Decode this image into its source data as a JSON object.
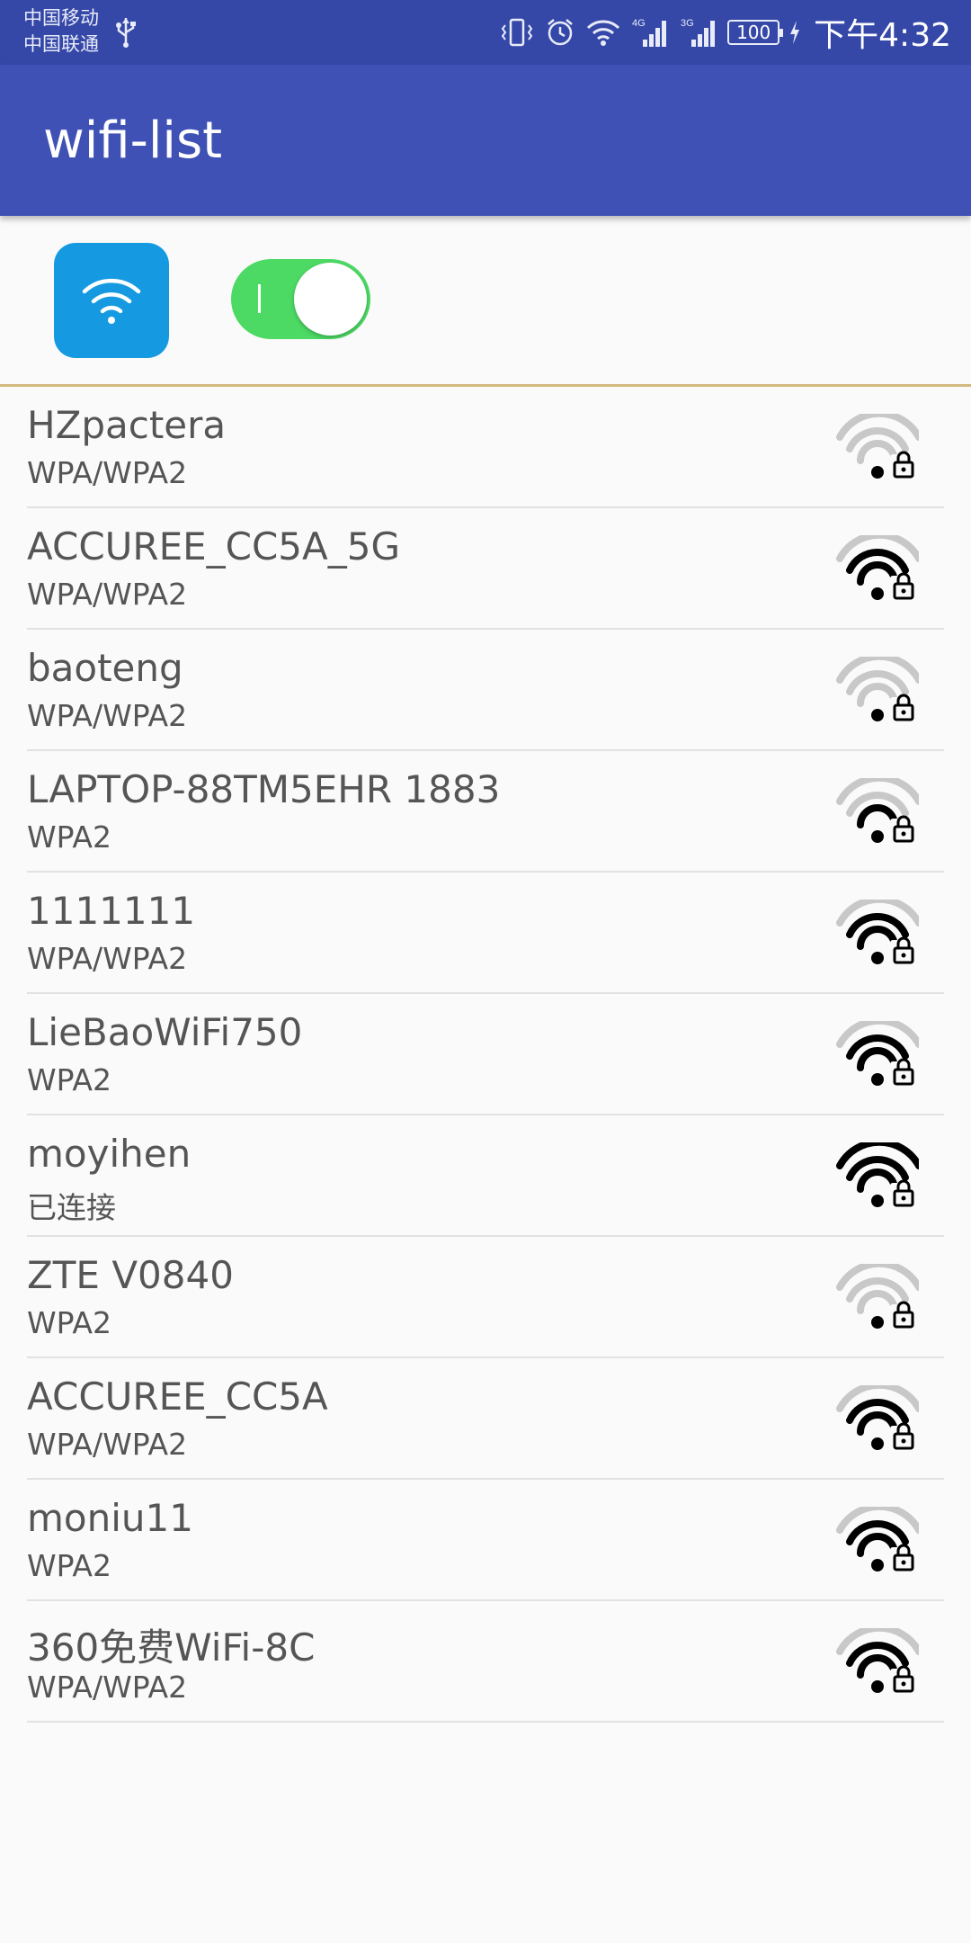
{
  "status_bar": {
    "carrier_1": "中国移动",
    "carrier_2": "中国联通",
    "network_1": "4G",
    "network_2": "3G",
    "battery": "100",
    "time": "下午4:32"
  },
  "app_bar": {
    "title": "wifi-list"
  },
  "controls": {
    "wifi_tile_color": "#159ae2",
    "toggle_on": true,
    "toggle_color": "#4cd964"
  },
  "colors": {
    "status_bar": "#3548a8",
    "app_bar": "#3f51b5",
    "divider_accent": "#d2b97d",
    "signal_active": "#000000",
    "signal_inactive": "#c8c8c8"
  },
  "networks": [
    {
      "ssid": "HZpactera",
      "security": "WPA/WPA2",
      "signal_bars": 1
    },
    {
      "ssid": "ACCUREE_CC5A_5G",
      "security": "WPA/WPA2",
      "signal_bars": 3
    },
    {
      "ssid": "baoteng",
      "security": "WPA/WPA2",
      "signal_bars": 1
    },
    {
      "ssid": "LAPTOP-88TM5EHR 1883",
      "security": "WPA2",
      "signal_bars": 2
    },
    {
      "ssid": "1111111",
      "security": "WPA/WPA2",
      "signal_bars": 3
    },
    {
      "ssid": "LieBaoWiFi750",
      "security": "WPA2",
      "signal_bars": 3
    },
    {
      "ssid": "moyihen",
      "security": "已连接",
      "signal_bars": 4
    },
    {
      "ssid": "ZTE V0840",
      "security": "WPA2",
      "signal_bars": 1
    },
    {
      "ssid": "ACCUREE_CC5A",
      "security": "WPA/WPA2",
      "signal_bars": 3
    },
    {
      "ssid": "moniu11",
      "security": "WPA2",
      "signal_bars": 3
    },
    {
      "ssid": "360免费WiFi-8C",
      "security": "WPA/WPA2",
      "signal_bars": 3
    }
  ]
}
